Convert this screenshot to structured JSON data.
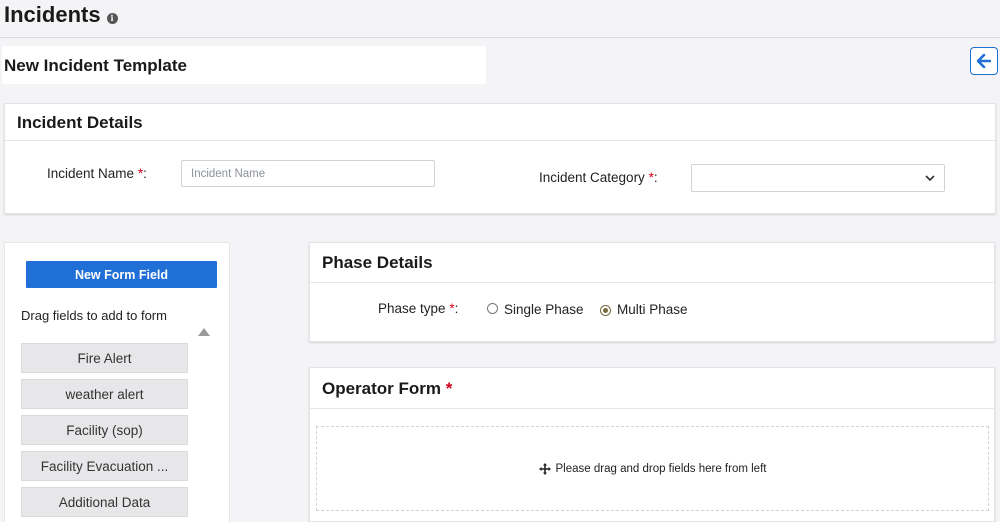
{
  "page": {
    "title": "Incidents"
  },
  "template": {
    "title": "New Incident Template"
  },
  "details": {
    "heading": "Incident Details",
    "name_label": "Incident Name",
    "required_mark": "*",
    "name_suffix": ":",
    "name_placeholder": "Incident Name",
    "name_value": "",
    "category_label": "Incident Category",
    "category_selected": ""
  },
  "left_panel": {
    "new_field_label": "New Form Field",
    "hint": "Drag fields to add to form",
    "fields": [
      "Fire Alert",
      "weather alert",
      "Facility (sop)",
      "Facility Evacuation ...",
      "Additional Data"
    ]
  },
  "phase": {
    "heading": "Phase Details",
    "type_label": "Phase type",
    "options": [
      "Single Phase",
      "Multi Phase"
    ],
    "selected": "Multi Phase"
  },
  "operator": {
    "heading": "Operator Form",
    "drop_hint": "Please drag and drop fields here from left"
  },
  "colors": {
    "accent": "#1f6fd6",
    "required": "#d0021b",
    "radio_checked": "#7b6a3f"
  }
}
